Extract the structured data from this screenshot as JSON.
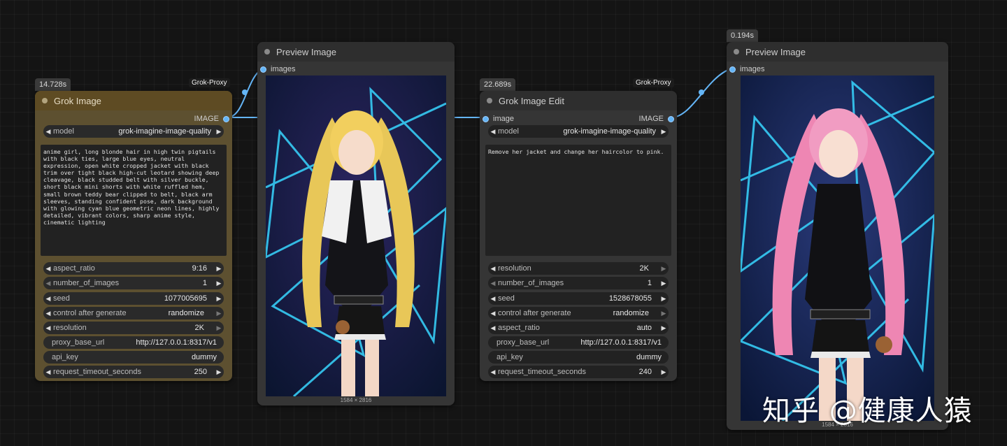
{
  "nodes": {
    "grok_image": {
      "timing": "14.728s",
      "badge": "Grok-Proxy",
      "title": "Grok Image",
      "output_label": "IMAGE",
      "model_label": "model",
      "model_value": "grok-imagine-image-quality",
      "prompt": "anime girl, long blonde hair in high twin pigtails with black ties, large blue eyes, neutral expression, open white cropped jacket with black trim over tight black high-cut leotard showing deep cleavage, black studded belt with silver buckle, short black mini shorts with white ruffled hem, small brown teddy bear clipped to belt, black arm sleeves, standing confident pose, dark background with glowing cyan blue geometric neon lines, highly detailed, vibrant colors, sharp anime style, cinematic lighting",
      "widgets": [
        {
          "label": "aspect_ratio",
          "value": "9:16"
        },
        {
          "label": "number_of_images",
          "value": "1"
        },
        {
          "label": "seed",
          "value": "1077005695"
        },
        {
          "label": "control after generate",
          "value": "randomize"
        },
        {
          "label": "resolution",
          "value": "2K"
        },
        {
          "label": "proxy_base_url",
          "value": "http://127.0.0.1:8317/v1"
        },
        {
          "label": "api_key",
          "value": "dummy"
        },
        {
          "label": "request_timeout_seconds",
          "value": "250"
        }
      ]
    },
    "preview_1": {
      "title": "Preview Image",
      "input_label": "images",
      "dims": "1584 × 2816"
    },
    "grok_edit": {
      "timing": "22.689s",
      "badge": "Grok-Proxy",
      "title": "Grok Image Edit",
      "input_label": "image",
      "output_label": "IMAGE",
      "model_label": "model",
      "model_value": "grok-imagine-image-quality",
      "prompt": "Remove her jacket and change her haircolor to pink.",
      "widgets": [
        {
          "label": "resolution",
          "value": "2K"
        },
        {
          "label": "number_of_images",
          "value": "1"
        },
        {
          "label": "seed",
          "value": "1528678055"
        },
        {
          "label": "control after generate",
          "value": "randomize"
        },
        {
          "label": "aspect_ratio",
          "value": "auto"
        },
        {
          "label": "proxy_base_url",
          "value": "http://127.0.0.1:8317/v1"
        },
        {
          "label": "api_key",
          "value": "dummy"
        },
        {
          "label": "request_timeout_seconds",
          "value": "240"
        }
      ]
    },
    "preview_2": {
      "timing": "0.194s",
      "title": "Preview Image",
      "input_label": "images",
      "dims": "1584 × 2816"
    }
  },
  "watermark": "知乎 @健康人猿",
  "colors": {
    "canvas": "#141414",
    "node": "#353535",
    "gold_node": "#5d5030",
    "link": "#64b5f6",
    "neon": "#38d6ff"
  }
}
